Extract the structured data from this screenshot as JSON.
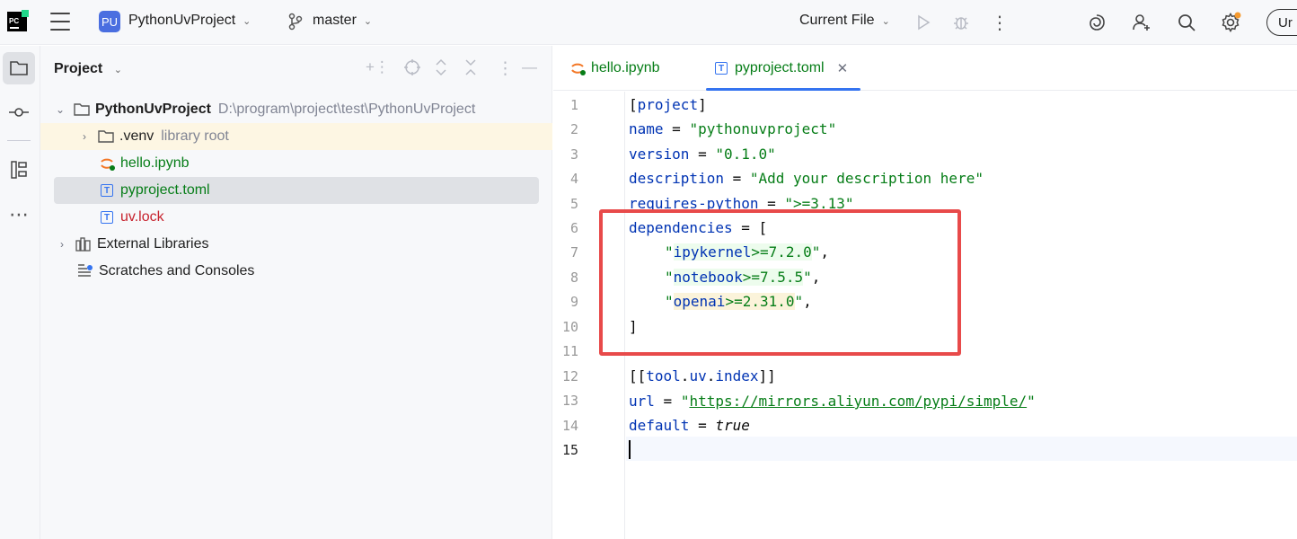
{
  "titlebar": {
    "project_badge": "PU",
    "project_name": "PythonUvProject",
    "branch": "master",
    "run_config": "Current File",
    "upgrade_label": "Ur"
  },
  "project_panel": {
    "title": "Project",
    "tree": [
      {
        "name": "PythonUvProject",
        "extra": "D:\\program\\project\\test\\PythonUvProject"
      },
      {
        "name": ".venv",
        "extra": "library root"
      },
      {
        "name": "hello.ipynb"
      },
      {
        "name": "pyproject.toml"
      },
      {
        "name": "uv.lock"
      },
      {
        "name": "External Libraries"
      },
      {
        "name": "Scratches and Consoles"
      }
    ]
  },
  "editor": {
    "tabs": [
      {
        "label": "hello.ipynb"
      },
      {
        "label": "pyproject.toml"
      }
    ],
    "line_numbers": [
      "1",
      "2",
      "3",
      "4",
      "5",
      "6",
      "7",
      "8",
      "9",
      "10",
      "11",
      "12",
      "13",
      "14",
      "15"
    ],
    "code": {
      "l1_open": "[",
      "l1_word": "project",
      "l1_close": "]",
      "l2_key": "name",
      "l2_eq": " = ",
      "l2_val": "\"pythonuvproject\"",
      "l3_key": "version",
      "l3_eq": " = ",
      "l3_val": "\"0.1.0\"",
      "l4_key": "description",
      "l4_eq": " = ",
      "l4_val": "\"Add your description here\"",
      "l5_key": "requires-python",
      "l5_eq": " = ",
      "l5_val": "\">=3.13\"",
      "l6_key": "dependencies",
      "l6_eq": " = [",
      "l7_q1": "\"",
      "l7_pkg": "ipykernel",
      "l7_ver": ">=7.2.0",
      "l7_q2": "\"",
      "l7_comma": ",",
      "l8_q1": "\"",
      "l8_pkg": "notebook",
      "l8_ver": ">=7.5.5",
      "l8_q2": "\"",
      "l8_comma": ",",
      "l9_q1": "\"",
      "l9_pkg": "openai",
      "l9_ver": ">=2.31.0",
      "l9_q2": "\"",
      "l9_comma": ",",
      "l10": "]",
      "l12_open": "[[",
      "l12_a": "tool",
      "l12_dot1": ".",
      "l12_b": "uv",
      "l12_dot2": ".",
      "l12_c": "index",
      "l12_close": "]]",
      "l13_key": "url",
      "l13_eq": " = ",
      "l13_q1": "\"",
      "l13_url": "https://mirrors.aliyun.com/pypi/simple/",
      "l13_q2": "\"",
      "l14_key": "default",
      "l14_eq": " = ",
      "l14_val": "true"
    }
  },
  "colors": {
    "accent": "#3574f0",
    "highlight_box": "#e84a4a",
    "keyword": "#0033b3",
    "string": "#067d17"
  }
}
